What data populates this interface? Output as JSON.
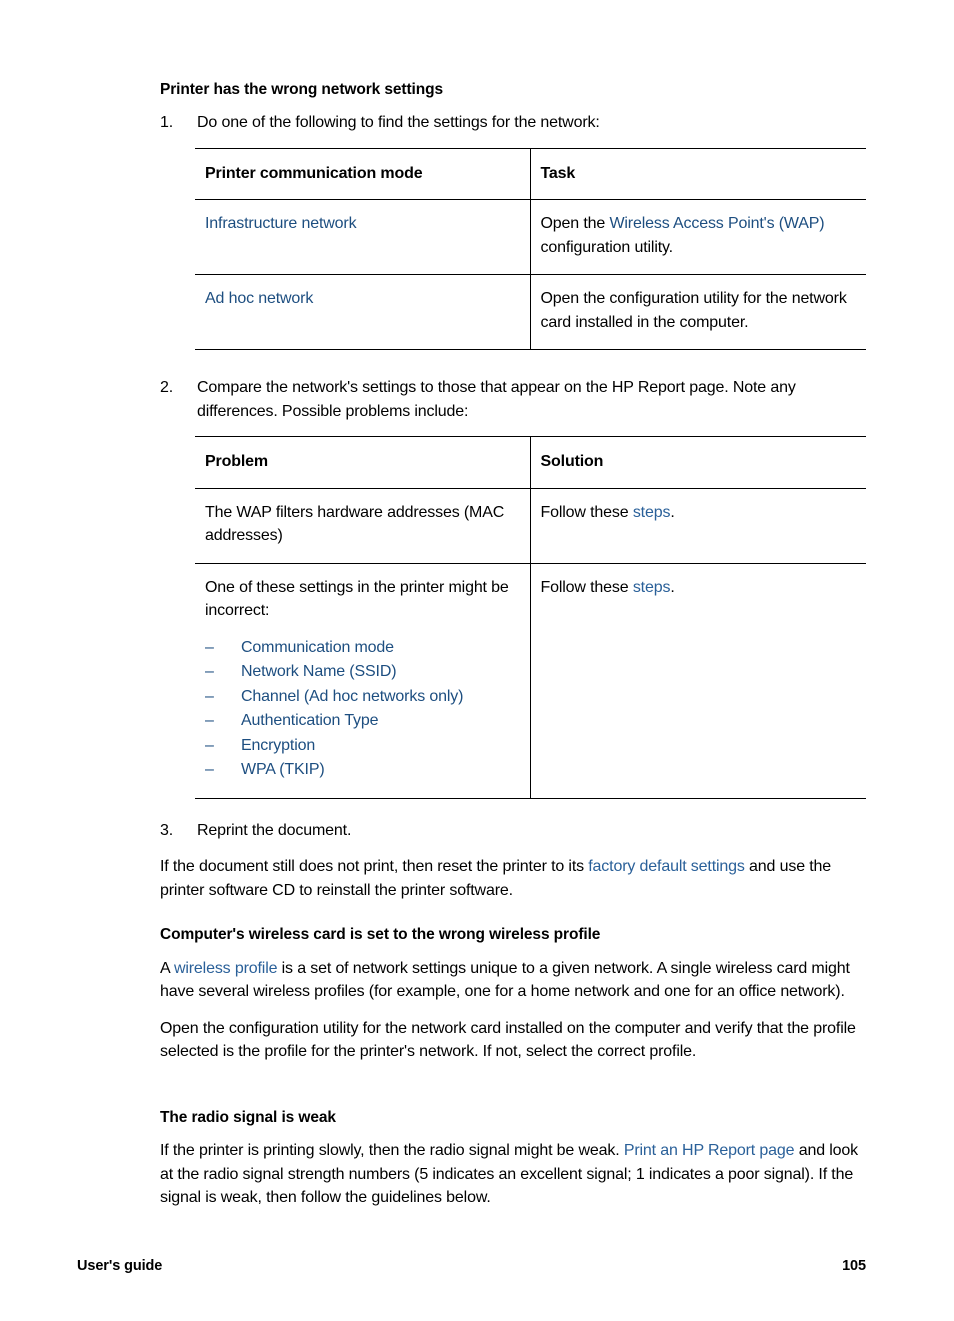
{
  "document": {
    "section1": {
      "heading": "Printer has the wrong network settings",
      "step1": {
        "number": "1.",
        "text": "Do one of the following to find the settings for the network:"
      },
      "table1": {
        "headers": [
          "Printer communication mode",
          "Task"
        ],
        "rows": [
          {
            "mode": "Infrastructure network",
            "task_prefix": "Open the ",
            "task_link": "Wireless Access Point's (WAP)",
            "task_suffix": " configuration utility."
          },
          {
            "mode": "Ad hoc network",
            "task_prefix": "Open the configuration utility for the network card installed in the computer.",
            "task_link": "",
            "task_suffix": ""
          }
        ]
      },
      "step2": {
        "number": "2.",
        "text": "Compare the network's settings to those that appear on the HP Report page. Note any differences. Possible problems include:"
      },
      "table2": {
        "headers": [
          "Problem",
          "Solution"
        ],
        "rows": [
          {
            "problem": "The WAP filters hardware addresses (MAC addresses)",
            "solution_prefix": "Follow these ",
            "solution_link": "steps",
            "solution_suffix": "."
          },
          {
            "problem": "One of these settings in the printer might be incorrect:",
            "problem_list": [
              "Communication mode",
              "Network Name (SSID)",
              "Channel (Ad hoc networks only)",
              "Authentication Type",
              "Encryption",
              "WPA (TKIP)"
            ],
            "dash": "–",
            "solution_prefix": "Follow these ",
            "solution_link": "steps",
            "solution_suffix": "."
          }
        ]
      },
      "step3": {
        "number": "3.",
        "text": "Reprint the document."
      },
      "closing_prefix": "If the document still does not print, then reset the printer to its ",
      "closing_link": "factory default settings",
      "closing_suffix": " and use the printer software CD to reinstall the printer software."
    },
    "section2": {
      "heading": "Computer's wireless card is set to the wrong wireless profile",
      "para1_prefix": "A ",
      "para1_link": "wireless profile",
      "para1_suffix": " is a set of network settings unique to a given network. A single wireless card might have several wireless profiles (for example, one for a home network and one for an office network).",
      "para2": "Open the configuration utility for the network card installed on the computer and verify that the profile selected is the profile for the printer's network. If not, select the correct profile."
    },
    "section3": {
      "heading": "The radio signal is weak",
      "para_prefix": "If the printer is printing slowly, then the radio signal might be weak. ",
      "para_link": "Print an HP Report page",
      "para_suffix": " and look at the radio signal strength numbers (5 indicates an excellent signal; 1 indicates a poor signal). If the signal is weak, then follow the guidelines below."
    }
  },
  "footer": {
    "left": "User's guide",
    "right": "105"
  },
  "colors": {
    "link": "#1d4e80",
    "link_bright": "#2a6099",
    "text": "#000000",
    "rule": "#000000"
  }
}
